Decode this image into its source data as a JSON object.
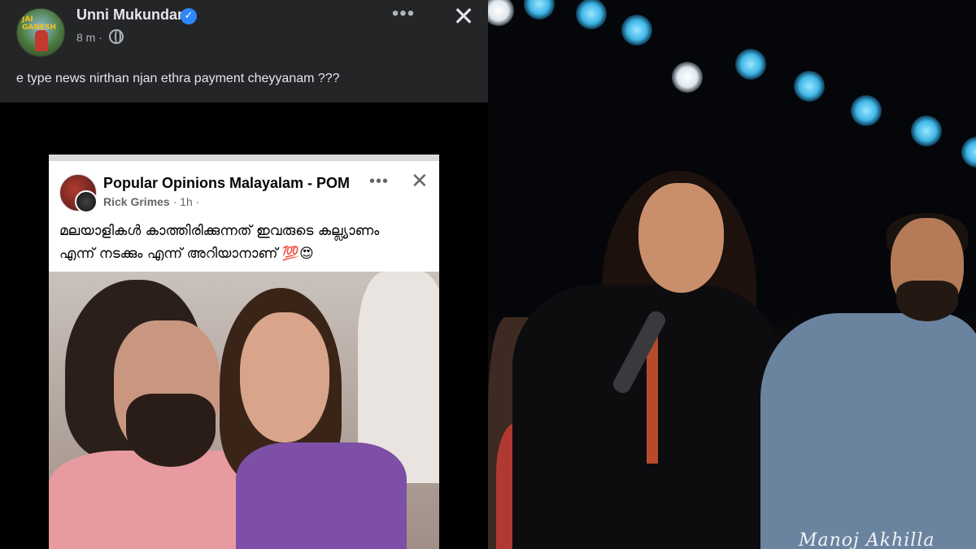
{
  "post": {
    "author": "Unni Mukundan",
    "verified_glyph": "✓",
    "time": "8 m ·",
    "more_glyph": "•••",
    "close_glyph": "✕",
    "text": "e type news nirthan njan ethra payment cheyyanam ???"
  },
  "embedded_post": {
    "page_name": "Popular Opinions Malayalam - POM",
    "author": "Rick Grimes",
    "time": "· 1h ·",
    "more_glyph": "•••",
    "close_glyph": "✕",
    "text_line1": "മലയാളികൾ കാത്തിരിക്കുന്നത് ഇവരുടെ കല്ല്യാണം",
    "text_line2": "എന്ന് നടക്കും എന്ന് അറിയാനാണ് 💯😍"
  },
  "photo": {
    "signature": "Manoj Akhilla"
  },
  "icons": {
    "verified": "verified-badge-icon",
    "globe": "globe-icon",
    "more": "more-options-icon",
    "close": "close-icon"
  },
  "colors": {
    "post_bg": "#242526",
    "text_primary": "#e4e6eb",
    "text_secondary": "#b0b3b8",
    "verified_blue": "#2d88ff",
    "stage_light": "#3fb6e6"
  }
}
